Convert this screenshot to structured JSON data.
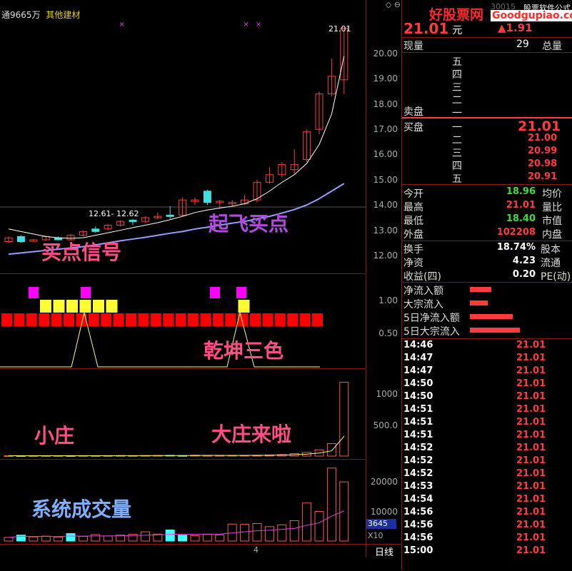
{
  "header": {
    "stock_info_left": "通9665万",
    "sector": "其他建材",
    "price_marker": "21.01",
    "range_label": "12.61- 12.62"
  },
  "watermark": {
    "title": "好股票网",
    "url": "Goodgupiao.com",
    "caption": "股票软件公式",
    "code_partial": "30015"
  },
  "price_axis": [
    "20.00",
    "19.00",
    "18.00",
    "17.00",
    "16.00",
    "15.00",
    "14.00",
    "13.00",
    "12.00"
  ],
  "indicator_axis": [
    "1.00",
    "0.50"
  ],
  "volume_axis_top": [
    "1000",
    "500.0"
  ],
  "volume_axis_bottom": [
    "20000",
    "10000"
  ],
  "volume_badge": "3645",
  "volume_x": "X10",
  "period_label": "日线",
  "date_tick": "4",
  "overlays": {
    "main": "起飞买点",
    "buy_signal": "买点信号",
    "qiankun": "乾坤三色",
    "small_dealer": "小庄",
    "big_dealer": "大庄来啦",
    "system_volume": "系统成交量"
  },
  "quote": {
    "price": "21.01",
    "unit": "元",
    "change": "▲1.91",
    "current_vol_label": "现量",
    "current_vol": "29",
    "total_label": "总量",
    "sell_label": "卖盘",
    "buy_label": "买盘",
    "sell_levels": [
      "五",
      "四",
      "三",
      "二",
      "一"
    ],
    "buy_levels": [
      {
        "lvl": "一",
        "price": "21.01"
      },
      {
        "lvl": "二",
        "price": "21.00"
      },
      {
        "lvl": "三",
        "price": "20.99"
      },
      {
        "lvl": "四",
        "price": "20.98"
      },
      {
        "lvl": "五",
        "price": "20.91"
      }
    ]
  },
  "stats": [
    {
      "label": "今开",
      "value": "18.96",
      "color": "green",
      "right": "均价"
    },
    {
      "label": "最高",
      "value": "21.01",
      "color": "red",
      "right": "量比"
    },
    {
      "label": "最低",
      "value": "18.40",
      "color": "green",
      "right": "市值"
    },
    {
      "label": "外盘",
      "value": "102208",
      "color": "red",
      "right": "内盘"
    }
  ],
  "fundamentals": [
    {
      "label": "换手",
      "value": "18.74%",
      "right": "股本"
    },
    {
      "label": "净资",
      "value": "4.23",
      "right": "流通"
    },
    {
      "label": "收益(四)",
      "value": "0.20",
      "right": "PE(动)"
    }
  ],
  "flows": [
    {
      "label": "净流入额",
      "bar": 0.3
    },
    {
      "label": "大宗流入",
      "bar": 0.25
    },
    {
      "label": "5日净流入额",
      "bar": 0.6
    },
    {
      "label": "5日大宗流入",
      "bar": 0.7
    }
  ],
  "ticks": [
    {
      "time": "14:46",
      "price": "21.01"
    },
    {
      "time": "14:47",
      "price": "21.01"
    },
    {
      "time": "14:47",
      "price": "21.01"
    },
    {
      "time": "14:50",
      "price": "21.01"
    },
    {
      "time": "14:50",
      "price": "21.01"
    },
    {
      "time": "14:51",
      "price": "21.01"
    },
    {
      "time": "14:51",
      "price": "21.01"
    },
    {
      "time": "14:51",
      "price": "21.01"
    },
    {
      "time": "14:52",
      "price": "21.01"
    },
    {
      "time": "14:52",
      "price": "21.01"
    },
    {
      "time": "14:52",
      "price": "21.01"
    },
    {
      "time": "14:53",
      "price": "21.01"
    },
    {
      "time": "14:54",
      "price": "21.01"
    },
    {
      "time": "14:56",
      "price": "21.01"
    },
    {
      "time": "14:56",
      "price": "21.01"
    },
    {
      "time": "14:56",
      "price": "21.01"
    },
    {
      "time": "15:00",
      "price": "21.01"
    }
  ],
  "chart_data": {
    "type": "candlestick",
    "candles": [
      {
        "o": 12.55,
        "c": 12.7,
        "h": 12.75,
        "l": 12.5,
        "up": true
      },
      {
        "o": 12.75,
        "c": 12.55,
        "h": 12.8,
        "l": 12.5,
        "up": false
      },
      {
        "o": 12.6,
        "c": 12.62,
        "h": 12.65,
        "l": 12.55,
        "up": true
      },
      {
        "o": 12.62,
        "c": 12.75,
        "h": 12.8,
        "l": 12.58,
        "up": true
      },
      {
        "o": 12.7,
        "c": 12.62,
        "h": 12.75,
        "l": 12.6,
        "up": false
      },
      {
        "o": 12.62,
        "c": 12.8,
        "h": 12.85,
        "l": 12.6,
        "up": true
      },
      {
        "o": 12.8,
        "c": 12.95,
        "h": 13.0,
        "l": 12.75,
        "up": true
      },
      {
        "o": 12.95,
        "c": 13.05,
        "h": 13.15,
        "l": 12.9,
        "up": false
      },
      {
        "o": 13.05,
        "c": 13.2,
        "h": 13.25,
        "l": 13.0,
        "up": true
      },
      {
        "o": 13.2,
        "c": 13.35,
        "h": 13.4,
        "l": 13.15,
        "up": true
      },
      {
        "o": 13.35,
        "c": 13.4,
        "h": 13.45,
        "l": 13.2,
        "up": false
      },
      {
        "o": 13.35,
        "c": 13.5,
        "h": 13.55,
        "l": 13.3,
        "up": true
      },
      {
        "o": 13.5,
        "c": 13.55,
        "h": 13.7,
        "l": 13.45,
        "up": true
      },
      {
        "o": 13.55,
        "c": 13.6,
        "h": 13.95,
        "l": 13.45,
        "up": false
      },
      {
        "o": 13.6,
        "c": 14.2,
        "h": 14.3,
        "l": 13.55,
        "up": true
      },
      {
        "o": 14.2,
        "c": 14.15,
        "h": 14.3,
        "l": 14.0,
        "up": true
      },
      {
        "o": 14.55,
        "c": 14.1,
        "h": 14.6,
        "l": 14.0,
        "up": false
      },
      {
        "o": 14.1,
        "c": 14.15,
        "h": 14.2,
        "l": 13.9,
        "up": true
      },
      {
        "o": 14.1,
        "c": 14.05,
        "h": 14.2,
        "l": 13.95,
        "up": true
      },
      {
        "o": 14.05,
        "c": 14.2,
        "h": 14.4,
        "l": 14.0,
        "up": true
      },
      {
        "o": 14.2,
        "c": 14.9,
        "h": 15.0,
        "l": 14.1,
        "up": true
      },
      {
        "o": 14.9,
        "c": 15.2,
        "h": 15.5,
        "l": 14.85,
        "up": true
      },
      {
        "o": 15.2,
        "c": 15.6,
        "h": 15.7,
        "l": 15.1,
        "up": true
      },
      {
        "o": 15.6,
        "c": 15.4,
        "h": 16.2,
        "l": 15.2,
        "up": true
      },
      {
        "o": 15.8,
        "c": 16.9,
        "h": 17.0,
        "l": 15.7,
        "up": true
      },
      {
        "o": 17.0,
        "c": 18.4,
        "h": 18.5,
        "l": 16.8,
        "up": true
      },
      {
        "o": 18.4,
        "c": 19.1,
        "h": 19.8,
        "l": 18.3,
        "up": true
      },
      {
        "o": 18.96,
        "c": 21.01,
        "h": 21.01,
        "l": 18.4,
        "up": true
      }
    ],
    "ma_short": [
      13.05,
      12.95,
      12.85,
      12.75,
      12.7,
      12.68,
      12.7,
      12.8,
      12.9,
      13.0,
      13.1,
      13.2,
      13.3,
      13.42,
      13.55,
      13.7,
      13.8,
      13.88,
      13.95,
      14.05,
      14.25,
      14.55,
      14.9,
      15.2,
      15.65,
      16.4,
      17.6,
      19.9
    ],
    "ma_long": [
      12.05,
      12.1,
      12.15,
      12.2,
      12.25,
      12.3,
      12.35,
      12.42,
      12.5,
      12.58,
      12.65,
      12.72,
      12.8,
      12.88,
      12.95,
      13.05,
      13.12,
      13.2,
      13.28,
      13.35,
      13.45,
      13.55,
      13.68,
      13.82,
      14.0,
      14.25,
      14.55,
      14.85
    ],
    "price_range": [
      11.8,
      21.5
    ],
    "signals_top": [
      6,
      16,
      17
    ],
    "qiankun": {
      "magenta": [
        2,
        6,
        16,
        18
      ],
      "yellow": [
        3,
        4,
        5,
        6,
        7,
        8,
        18
      ],
      "red_count": 26,
      "spikes": [
        6,
        18
      ]
    },
    "small_vol": [
      5,
      5,
      5,
      6,
      6,
      6,
      7,
      6,
      7,
      8,
      7,
      9,
      10,
      12,
      8,
      14,
      10,
      10,
      11,
      12,
      14,
      18,
      24,
      40,
      60,
      100,
      200,
      1180
    ],
    "small_vol_range": [
      0,
      1300
    ],
    "system_vol": [
      1400,
      2300,
      1600,
      1900,
      1500,
      2900,
      1800,
      2500,
      2000,
      2300,
      2600,
      3600,
      2700,
      4300,
      2300,
      2100,
      2600,
      2400,
      6600,
      6500,
      6800,
      5600,
      6300,
      7900,
      14800,
      11500,
      28400,
      23000
    ],
    "system_vol_cyan": [
      1,
      5,
      13,
      14
    ],
    "system_vol_range": [
      0,
      30000
    ]
  }
}
